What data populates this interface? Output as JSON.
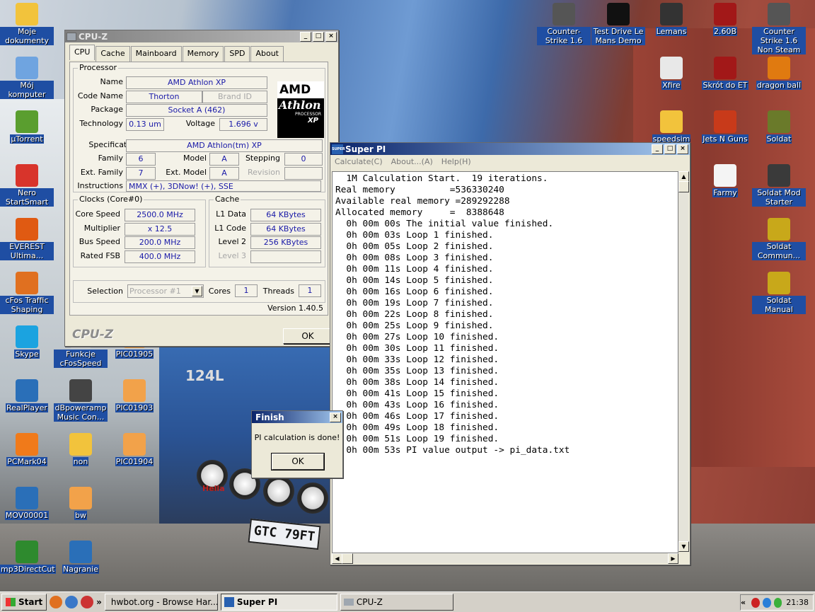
{
  "desktop": {
    "icons_left": [
      {
        "label": "Moje dokumenty",
        "icon": "folder-icon",
        "color": "#f2c33c"
      },
      {
        "label": "Mój komputer",
        "icon": "computer-icon",
        "color": "#6fa4e0"
      },
      {
        "label": "µTorrent",
        "icon": "utorrent-icon",
        "color": "#5a9e2f"
      },
      {
        "label": "Nero StartSmart",
        "icon": "nero-icon",
        "color": "#d8342b"
      },
      {
        "label": "EVEREST Ultima...",
        "icon": "everest-icon",
        "color": "#e05a12"
      },
      {
        "label": "cFos Traffic Shaping",
        "icon": "firefox-icon",
        "color": "#e07020"
      },
      {
        "label": "Skype",
        "icon": "skype-icon",
        "color": "#1ba3e0"
      },
      {
        "label": "RealPlayer",
        "icon": "realplayer-icon",
        "color": "#2a6fb8"
      },
      {
        "label": "PCMark04",
        "icon": "pcmark-icon",
        "color": "#f07a1a"
      },
      {
        "label": "MOV00001",
        "icon": "media-file-icon",
        "color": "#2a6fb8"
      },
      {
        "label": "mp3DirectCut",
        "icon": "mp3directcut-icon",
        "color": "#2e8a2e"
      }
    ],
    "icons_mid": [
      {
        "label": "Funkcje cFosSpeed",
        "icon": "shortcut-icon",
        "color": "#d8d8d8"
      },
      {
        "label": "PIC01905",
        "icon": "image-file-icon",
        "color": "#f2a24a"
      },
      {
        "label": "dBpoweramp Music Con...",
        "icon": "speaker-icon",
        "color": "#444444"
      },
      {
        "label": "PIC01903",
        "icon": "image-file-icon",
        "color": "#f2a24a"
      },
      {
        "label": "non",
        "icon": "folder-icon",
        "color": "#f2c33c"
      },
      {
        "label": "PIC01904",
        "icon": "image-file-icon",
        "color": "#f2a24a"
      },
      {
        "label": "bw",
        "icon": "image-file-icon",
        "color": "#f2a24a"
      },
      {
        "label": "Nagranie",
        "icon": "media-file-icon",
        "color": "#2a6fb8"
      }
    ],
    "icons_right": [
      {
        "label": "Counter-Strike 1.6",
        "icon": "counter-strike-icon",
        "color": "#555555"
      },
      {
        "label": "Test Drive Le Mans Demo",
        "icon": "testdrive-icon",
        "color": "#111111"
      },
      {
        "label": "Lemans",
        "icon": "steering-wheel-icon",
        "color": "#333333"
      },
      {
        "label": "2.60B",
        "icon": "et-icon",
        "color": "#a21818"
      },
      {
        "label": "Counter Strike 1.6 Non Steam",
        "icon": "counter-strike-icon",
        "color": "#555555"
      },
      {
        "label": "Xfire",
        "icon": "xfire-icon",
        "color": "#e8e8e8"
      },
      {
        "label": "Skrót do ET",
        "icon": "et-icon",
        "color": "#a21818"
      },
      {
        "label": "dragon ball",
        "icon": "halflife-icon",
        "color": "#e07a10"
      },
      {
        "label": "speedsim",
        "icon": "folder-icon",
        "color": "#f2c33c"
      },
      {
        "label": "Jets N Guns",
        "icon": "jets-icon",
        "color": "#c83a1a"
      },
      {
        "label": "Soldat",
        "icon": "soldat-icon",
        "color": "#6a7a2a"
      },
      {
        "label": "Farmy",
        "icon": "document-icon",
        "color": "#f4f4f4"
      },
      {
        "label": "Soldat Mod Starter",
        "icon": "soldat-icon",
        "color": "#3a3a3a"
      },
      {
        "label": "Soldat Commun...",
        "icon": "soldat-icon",
        "color": "#c8a81a"
      },
      {
        "label": "Soldat Manual",
        "icon": "soldat-icon",
        "color": "#c8a81a"
      }
    ],
    "plate_text": "GTC 79FT",
    "grille_badge": "124L",
    "light_brand": "Hella"
  },
  "cpuz": {
    "title": "CPU-Z",
    "tabs": [
      "CPU",
      "Cache",
      "Mainboard",
      "Memory",
      "SPD",
      "About"
    ],
    "processor_group": "Processor",
    "name_label": "Name",
    "name": "AMD Athlon XP",
    "codename_label": "Code Name",
    "codename": "Thorton",
    "brandid_label": "Brand ID",
    "package_label": "Package",
    "package": "Socket A (462)",
    "technology_label": "Technology",
    "technology": "0.13 um",
    "voltage_label": "Voltage",
    "voltage": "1.696 v",
    "spec_label": "Specification",
    "spec": "AMD Athlon(tm) XP",
    "family_label": "Family",
    "family": "6",
    "model_label": "Model",
    "model": "A",
    "stepping_label": "Stepping",
    "stepping": "0",
    "extfamily_label": "Ext. Family",
    "extfamily": "7",
    "extmodel_label": "Ext. Model",
    "extmodel": "A",
    "revision_label": "Revision",
    "instructions_label": "Instructions",
    "instructions": "MMX (+), 3DNow! (+), SSE",
    "clocks_group": "Clocks (Core#0)",
    "corespeed_label": "Core Speed",
    "corespeed": "2500.0 MHz",
    "multiplier_label": "Multiplier",
    "multiplier": "x 12.5",
    "busspeed_label": "Bus Speed",
    "busspeed": "200.0 MHz",
    "ratedfsb_label": "Rated FSB",
    "ratedfsb": "400.0 MHz",
    "cache_group": "Cache",
    "l1data_label": "L1 Data",
    "l1data": "64 KBytes",
    "l1code_label": "L1 Code",
    "l1code": "64 KBytes",
    "level2_label": "Level 2",
    "level2": "256 KBytes",
    "level3_label": "Level 3",
    "selection_label": "Selection",
    "selection": "Processor #1",
    "cores_label": "Cores",
    "cores": "1",
    "threads_label": "Threads",
    "threads": "1",
    "version": "Version 1.40.5",
    "brand": "CPU-Z",
    "ok": "OK",
    "logo_amd": "AMD",
    "logo_athlon": "Athlon",
    "logo_processor": "PROCESSOR",
    "logo_xp": "XP"
  },
  "superpi": {
    "title": "Super PI",
    "icon_text": "SUPER",
    "menu": [
      "Calculate(C)",
      "About...(A)",
      "Help(H)"
    ],
    "output": "  1M Calculation Start.  19 iterations.\nReal memory          =536330240\nAvailable real memory =289292288\nAllocated memory     =  8388648\n  0h 00m 00s The initial value finished.\n  0h 00m 03s Loop 1 finished.\n  0h 00m 05s Loop 2 finished.\n  0h 00m 08s Loop 3 finished.\n  0h 00m 11s Loop 4 finished.\n  0h 00m 14s Loop 5 finished.\n  0h 00m 16s Loop 6 finished.\n  0h 00m 19s Loop 7 finished.\n  0h 00m 22s Loop 8 finished.\n  0h 00m 25s Loop 9 finished.\n  0h 00m 27s Loop 10 finished.\n  0h 00m 30s Loop 11 finished.\n  0h 00m 33s Loop 12 finished.\n  0h 00m 35s Loop 13 finished.\n  0h 00m 38s Loop 14 finished.\n  0h 00m 41s Loop 15 finished.\n  0h 00m 43s Loop 16 finished.\n  0h 00m 46s Loop 17 finished.\n  0h 00m 49s Loop 18 finished.\n  0h 00m 51s Loop 19 finished.\n  0h 00m 53s PI value output -> pi_data.txt"
  },
  "finish": {
    "title": "Finish",
    "message": "PI calculation is done!",
    "ok": "OK"
  },
  "taskbar": {
    "start": "Start",
    "more": "»",
    "tasks": [
      "hwbot.org - Browse Har...",
      "Super PI",
      "CPU-Z"
    ],
    "clock": "21:38",
    "tray_more": "«"
  }
}
